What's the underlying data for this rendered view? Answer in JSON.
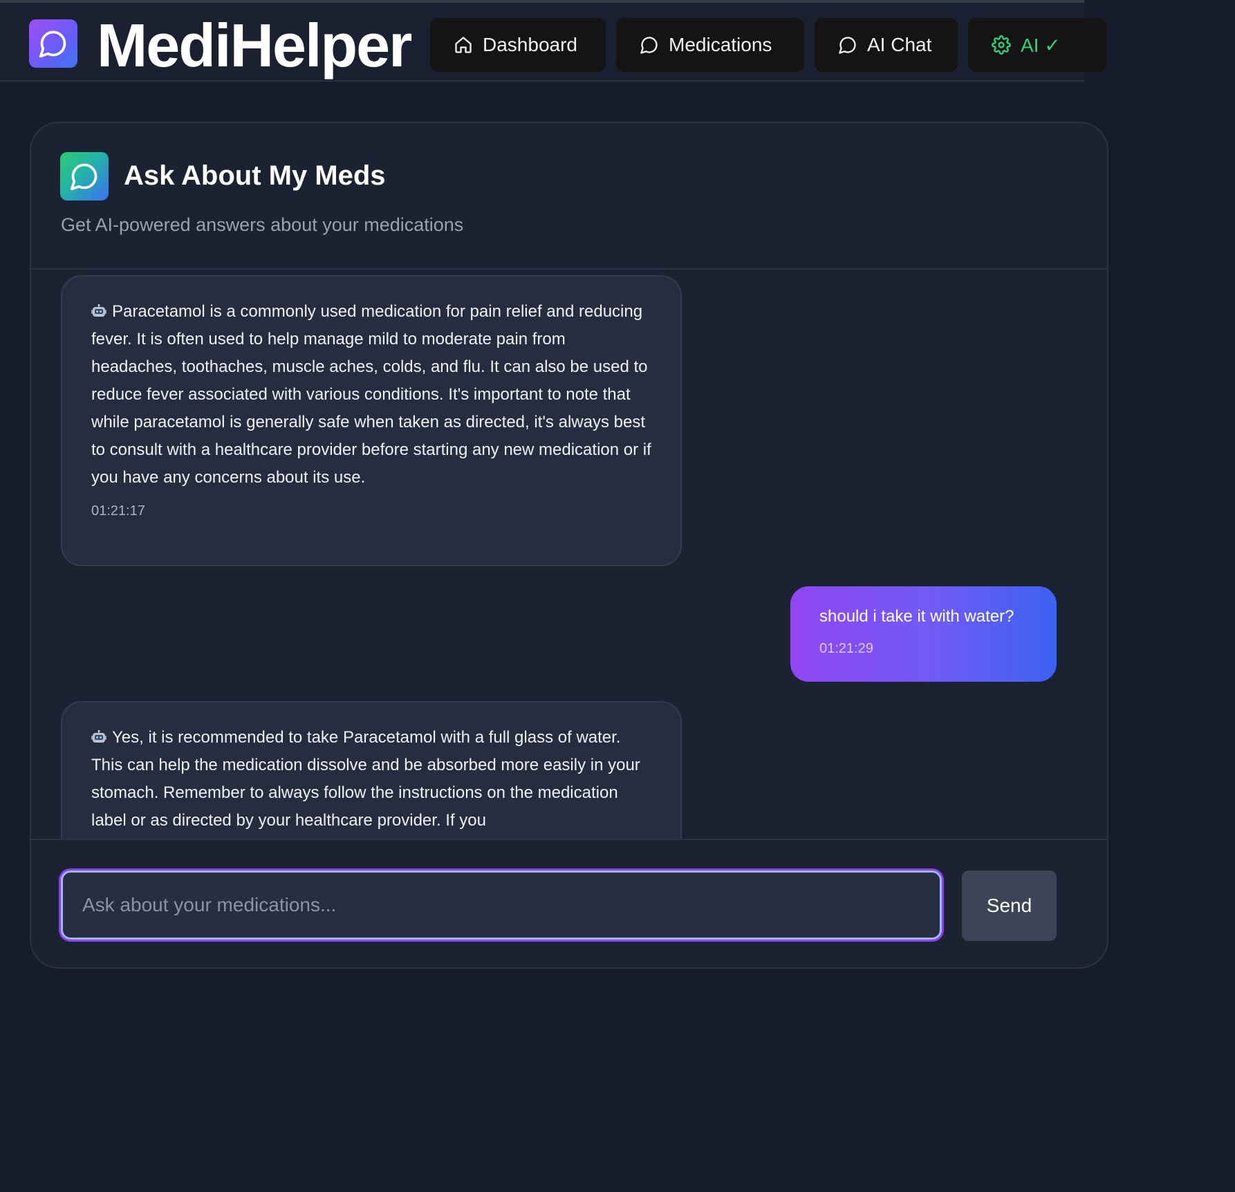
{
  "app": {
    "title": "MediHelper"
  },
  "nav": [
    {
      "label": "Dashboard",
      "icon": "home-icon"
    },
    {
      "label": "Medications",
      "icon": "chat-bubble-icon"
    },
    {
      "label": "AI Chat",
      "icon": "chat-bubble-icon"
    },
    {
      "label": "AI ✓",
      "icon": "gear-icon"
    }
  ],
  "colors": {
    "ai_status": "#34d27a",
    "user_bubble_start": "#9146f2",
    "user_bubble_end": "#3c62f1"
  },
  "chat": {
    "title": "Ask About My Meds",
    "subtitle": "Get AI-powered answers about your medications",
    "messages": [
      {
        "role": "assistant",
        "icon": "robot-icon",
        "text": "Paracetamol is a commonly used medication for pain relief and reducing fever. It is often used to help manage mild to moderate pain from headaches, toothaches, muscle aches, colds, and flu. It can also be used to reduce fever associated with various conditions. It's important to note that while paracetamol is generally safe when taken as directed, it's always best to consult with a healthcare provider before starting any new medication or if you have any concerns about its use.",
        "time": "01:21:17"
      },
      {
        "role": "user",
        "text": "should i take it with water?",
        "time": "01:21:29"
      },
      {
        "role": "assistant",
        "icon": "robot-icon",
        "text": "Yes, it is recommended to take Paracetamol with a full glass of water. This can help the medication dissolve and be absorbed more easily in your stomach. Remember to always follow the instructions on the medication label or as directed by your healthcare provider. If you",
        "time": ""
      }
    ],
    "input": {
      "placeholder": "Ask about your medications...",
      "value": ""
    },
    "send_label": "Send"
  }
}
